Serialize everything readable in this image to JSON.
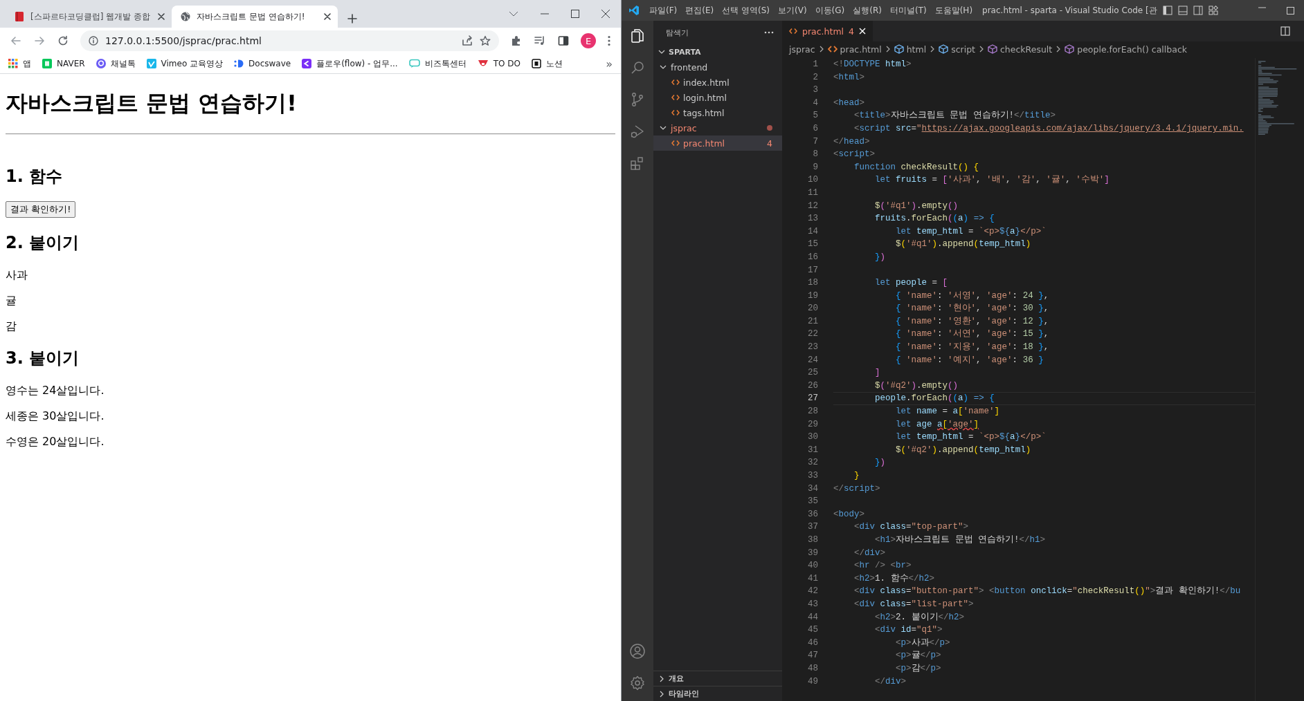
{
  "browser": {
    "tabs": [
      {
        "title": "[스파르타코딩클럽] 웹개발 종합",
        "kind": "book",
        "selected": false
      },
      {
        "title": "자바스크립트 문법 연습하기!",
        "kind": "globe",
        "selected": true
      }
    ],
    "address": "127.0.0.1:5500/jsprac/prac.html",
    "avatar": "E",
    "bookmarks": [
      {
        "label": "앱",
        "kind": "apps"
      },
      {
        "label": "NAVER",
        "kind": "naver"
      },
      {
        "label": "채널톡",
        "kind": "channel"
      },
      {
        "label": "Vimeo 교육영상",
        "kind": "vimeo"
      },
      {
        "label": "Docswave",
        "kind": "docswave"
      },
      {
        "label": "플로우(flow) - 업무...",
        "kind": "flow"
      },
      {
        "label": "비즈톡센터",
        "kind": "biztalk"
      },
      {
        "label": "TO DO",
        "kind": "todo"
      },
      {
        "label": "노션",
        "kind": "notion"
      }
    ],
    "bookmarks_overflow": "»",
    "page": {
      "title": "자바스크립트 문법 연습하기!",
      "sections": [
        {
          "heading": "1. 함수",
          "button": "결과 확인하기!"
        },
        {
          "heading": "2. 붙이기",
          "items": [
            "사과",
            "귤",
            "감"
          ]
        },
        {
          "heading": "3. 붙이기",
          "items": [
            "영수는 24살입니다.",
            "세종은 30살입니다.",
            "수영은 20살입니다."
          ]
        }
      ]
    }
  },
  "vscode": {
    "menu": [
      "파일(F)",
      "편집(E)",
      "선택 영역(S)",
      "보기(V)",
      "이동(G)",
      "실행(R)",
      "터미널(T)",
      "도움말(H)"
    ],
    "title": "prac.html - sparta - Visual Studio Code [관",
    "explorer": {
      "title": "탐색기",
      "root": "SPARTA",
      "tree": [
        {
          "label": "frontend",
          "expanded": true,
          "selected": false,
          "has_errors": false,
          "children": [
            {
              "label": "index.html",
              "selected": false,
              "has_errors": false
            },
            {
              "label": "login.html",
              "selected": false,
              "has_errors": false
            },
            {
              "label": "tags.html",
              "selected": false,
              "has_errors": false
            }
          ]
        },
        {
          "label": "jsprac",
          "expanded": true,
          "selected": false,
          "has_errors": true,
          "children": [
            {
              "label": "prac.html",
              "selected": true,
              "has_errors": true,
              "problems": "4"
            }
          ]
        }
      ],
      "panels": [
        {
          "label": "개요",
          "expanded": false
        },
        {
          "label": "타임라인",
          "expanded": false
        }
      ]
    },
    "editor_tab": {
      "label": "prac.html",
      "problems": "4"
    },
    "breadcrumbs": [
      {
        "label": "jsprac",
        "kind": "folder"
      },
      {
        "label": "prac.html",
        "kind": "file"
      },
      {
        "label": "html",
        "kind": "element"
      },
      {
        "label": "script",
        "kind": "element"
      },
      {
        "label": "checkResult",
        "kind": "method"
      },
      {
        "label": "people.forEach() callback",
        "kind": "method"
      }
    ],
    "lines": [
      {
        "number": "1",
        "current": false,
        "tokens": [
          {
            "kind": "p",
            "text": "<!"
          },
          {
            "kind": "tag",
            "text": "DOCTYPE"
          },
          {
            "kind": "attr",
            "text": " html"
          },
          {
            "kind": "p",
            "text": ">"
          }
        ]
      },
      {
        "number": "2",
        "current": false,
        "tokens": [
          {
            "kind": "p",
            "text": "<"
          },
          {
            "kind": "tag",
            "text": "html"
          },
          {
            "kind": "p",
            "text": ">"
          }
        ]
      },
      {
        "number": "3",
        "current": false
      },
      {
        "number": "4",
        "current": false,
        "tokens": [
          {
            "kind": "p",
            "text": "<"
          },
          {
            "kind": "tag",
            "text": "head"
          },
          {
            "kind": "p",
            "text": ">"
          }
        ]
      },
      {
        "number": "5",
        "current": false,
        "tokens": [
          {
            "kind": "p",
            "text": "    <"
          },
          {
            "kind": "tag",
            "text": "title"
          },
          {
            "kind": "p",
            "text": ">"
          },
          {
            "kind": "txt",
            "text": "자바스크립트 문법 연습하기!"
          },
          {
            "kind": "p",
            "text": "</"
          },
          {
            "kind": "tag",
            "text": "title"
          },
          {
            "kind": "p",
            "text": ">"
          }
        ]
      },
      {
        "number": "6",
        "current": false,
        "tokens": [
          {
            "kind": "p",
            "text": "    <"
          },
          {
            "kind": "tag",
            "text": "script"
          },
          {
            "kind": "attr",
            "text": " src"
          },
          {
            "kind": "txt",
            "text": "="
          },
          {
            "kind": "str",
            "text": "\""
          },
          {
            "kind": "url",
            "text": "https://ajax.googleapis.com/ajax/libs/jquery/3.4.1/jquery.min."
          }
        ]
      },
      {
        "number": "7",
        "current": false,
        "tokens": [
          {
            "kind": "p",
            "text": "</"
          },
          {
            "kind": "tag",
            "text": "head"
          },
          {
            "kind": "p",
            "text": ">"
          }
        ]
      },
      {
        "number": "8",
        "current": false,
        "tokens": [
          {
            "kind": "p",
            "text": "<"
          },
          {
            "kind": "tag",
            "text": "script"
          },
          {
            "kind": "p",
            "text": ">"
          }
        ]
      },
      {
        "number": "9",
        "current": false,
        "tokens": [
          {
            "kind": "kw",
            "text": "    function"
          },
          {
            "kind": "fn",
            "text": " checkResult"
          },
          {
            "kind": "y",
            "text": "()"
          },
          {
            "kind": "y",
            "text": " {"
          }
        ]
      },
      {
        "number": "10",
        "current": false,
        "tokens": [
          {
            "kind": "kw",
            "text": "        let"
          },
          {
            "kind": "var",
            "text": " fruits"
          },
          {
            "kind": "txt",
            "text": " = "
          },
          {
            "kind": "m",
            "text": "["
          },
          {
            "kind": "str",
            "text": "'사과'"
          },
          {
            "kind": "txt",
            "text": ", "
          },
          {
            "kind": "str",
            "text": "'배'"
          },
          {
            "kind": "txt",
            "text": ", "
          },
          {
            "kind": "str",
            "text": "'감'"
          },
          {
            "kind": "txt",
            "text": ", "
          },
          {
            "kind": "str",
            "text": "'귤'"
          },
          {
            "kind": "txt",
            "text": ", "
          },
          {
            "kind": "str",
            "text": "'수박'"
          },
          {
            "kind": "m",
            "text": "]"
          }
        ]
      },
      {
        "number": "11",
        "current": false
      },
      {
        "number": "12",
        "current": false,
        "tokens": [
          {
            "kind": "fn",
            "text": "        $"
          },
          {
            "kind": "m",
            "text": "("
          },
          {
            "kind": "str",
            "text": "'#q1'"
          },
          {
            "kind": "m",
            "text": ")"
          },
          {
            "kind": "txt",
            "text": "."
          },
          {
            "kind": "fn",
            "text": "empty"
          },
          {
            "kind": "m",
            "text": "()"
          }
        ]
      },
      {
        "number": "13",
        "current": false,
        "tokens": [
          {
            "kind": "var",
            "text": "        fruits"
          },
          {
            "kind": "txt",
            "text": "."
          },
          {
            "kind": "fn",
            "text": "forEach"
          },
          {
            "kind": "m",
            "text": "("
          },
          {
            "kind": "b",
            "text": "("
          },
          {
            "kind": "var",
            "text": "a"
          },
          {
            "kind": "b",
            "text": ")"
          },
          {
            "kind": "kw",
            "text": " =>"
          },
          {
            "kind": "b",
            "text": " {"
          }
        ]
      },
      {
        "number": "14",
        "current": false,
        "tokens": [
          {
            "kind": "kw",
            "text": "            let"
          },
          {
            "kind": "var",
            "text": " temp_html"
          },
          {
            "kind": "txt",
            "text": " = "
          },
          {
            "kind": "str",
            "text": "`<p>"
          },
          {
            "kind": "kw",
            "text": "${"
          },
          {
            "kind": "var",
            "text": "a"
          },
          {
            "kind": "kw",
            "text": "}"
          },
          {
            "kind": "str",
            "text": "</p>`"
          }
        ]
      },
      {
        "number": "15",
        "current": false,
        "tokens": [
          {
            "kind": "fn",
            "text": "            $"
          },
          {
            "kind": "y",
            "text": "("
          },
          {
            "kind": "str",
            "text": "'#q1'"
          },
          {
            "kind": "y",
            "text": ")"
          },
          {
            "kind": "txt",
            "text": "."
          },
          {
            "kind": "fn",
            "text": "append"
          },
          {
            "kind": "y",
            "text": "("
          },
          {
            "kind": "var",
            "text": "temp_html"
          },
          {
            "kind": "y",
            "text": ")"
          }
        ]
      },
      {
        "number": "16",
        "current": false,
        "tokens": [
          {
            "kind": "b",
            "text": "        }"
          },
          {
            "kind": "m",
            "text": ")"
          }
        ]
      },
      {
        "number": "17",
        "current": false
      },
      {
        "number": "18",
        "current": false,
        "tokens": [
          {
            "kind": "kw",
            "text": "        let"
          },
          {
            "kind": "var",
            "text": " people"
          },
          {
            "kind": "txt",
            "text": " = "
          },
          {
            "kind": "m",
            "text": "["
          }
        ]
      },
      {
        "number": "19",
        "current": false,
        "tokens": [
          {
            "kind": "b",
            "text": "            {"
          },
          {
            "kind": "str",
            "text": " 'name'"
          },
          {
            "kind": "txt",
            "text": ": "
          },
          {
            "kind": "str",
            "text": "'서영'"
          },
          {
            "kind": "txt",
            "text": ", "
          },
          {
            "kind": "str",
            "text": "'age'"
          },
          {
            "kind": "txt",
            "text": ": "
          },
          {
            "kind": "num",
            "text": "24"
          },
          {
            "kind": "b",
            "text": " }"
          },
          {
            "kind": "txt",
            "text": ","
          }
        ]
      },
      {
        "number": "20",
        "current": false,
        "tokens": [
          {
            "kind": "b",
            "text": "            {"
          },
          {
            "kind": "str",
            "text": " 'name'"
          },
          {
            "kind": "txt",
            "text": ": "
          },
          {
            "kind": "str",
            "text": "'현아'"
          },
          {
            "kind": "txt",
            "text": ", "
          },
          {
            "kind": "str",
            "text": "'age'"
          },
          {
            "kind": "txt",
            "text": ": "
          },
          {
            "kind": "num",
            "text": "30"
          },
          {
            "kind": "b",
            "text": " }"
          },
          {
            "kind": "txt",
            "text": ","
          }
        ]
      },
      {
        "number": "21",
        "current": false,
        "tokens": [
          {
            "kind": "b",
            "text": "            {"
          },
          {
            "kind": "str",
            "text": " 'name'"
          },
          {
            "kind": "txt",
            "text": ": "
          },
          {
            "kind": "str",
            "text": "'영환'"
          },
          {
            "kind": "txt",
            "text": ", "
          },
          {
            "kind": "str",
            "text": "'age'"
          },
          {
            "kind": "txt",
            "text": ": "
          },
          {
            "kind": "num",
            "text": "12"
          },
          {
            "kind": "b",
            "text": " }"
          },
          {
            "kind": "txt",
            "text": ","
          }
        ]
      },
      {
        "number": "22",
        "current": false,
        "tokens": [
          {
            "kind": "b",
            "text": "            {"
          },
          {
            "kind": "str",
            "text": " 'name'"
          },
          {
            "kind": "txt",
            "text": ": "
          },
          {
            "kind": "str",
            "text": "'서연'"
          },
          {
            "kind": "txt",
            "text": ", "
          },
          {
            "kind": "str",
            "text": "'age'"
          },
          {
            "kind": "txt",
            "text": ": "
          },
          {
            "kind": "num",
            "text": "15"
          },
          {
            "kind": "b",
            "text": " }"
          },
          {
            "kind": "txt",
            "text": ","
          }
        ]
      },
      {
        "number": "23",
        "current": false,
        "tokens": [
          {
            "kind": "b",
            "text": "            {"
          },
          {
            "kind": "str",
            "text": " 'name'"
          },
          {
            "kind": "txt",
            "text": ": "
          },
          {
            "kind": "str",
            "text": "'지용'"
          },
          {
            "kind": "txt",
            "text": ", "
          },
          {
            "kind": "str",
            "text": "'age'"
          },
          {
            "kind": "txt",
            "text": ": "
          },
          {
            "kind": "num",
            "text": "18"
          },
          {
            "kind": "b",
            "text": " }"
          },
          {
            "kind": "txt",
            "text": ","
          }
        ]
      },
      {
        "number": "24",
        "current": false,
        "tokens": [
          {
            "kind": "b",
            "text": "            {"
          },
          {
            "kind": "str",
            "text": " 'name'"
          },
          {
            "kind": "txt",
            "text": ": "
          },
          {
            "kind": "str",
            "text": "'예지'"
          },
          {
            "kind": "txt",
            "text": ", "
          },
          {
            "kind": "str",
            "text": "'age'"
          },
          {
            "kind": "txt",
            "text": ": "
          },
          {
            "kind": "num",
            "text": "36"
          },
          {
            "kind": "b",
            "text": " }"
          }
        ]
      },
      {
        "number": "25",
        "current": false,
        "tokens": [
          {
            "kind": "m",
            "text": "        ]"
          }
        ]
      },
      {
        "number": "26",
        "current": false,
        "tokens": [
          {
            "kind": "fn",
            "text": "        $"
          },
          {
            "kind": "m",
            "text": "("
          },
          {
            "kind": "str",
            "text": "'#q2'"
          },
          {
            "kind": "m",
            "text": ")"
          },
          {
            "kind": "txt",
            "text": "."
          },
          {
            "kind": "fn",
            "text": "empty"
          },
          {
            "kind": "m",
            "text": "()"
          }
        ]
      },
      {
        "number": "27",
        "current": true,
        "tokens": [
          {
            "kind": "var",
            "text": "        people"
          },
          {
            "kind": "txt",
            "text": "."
          },
          {
            "kind": "fn",
            "text": "forEach"
          },
          {
            "kind": "m",
            "text": "("
          },
          {
            "kind": "b",
            "text": "("
          },
          {
            "kind": "var",
            "text": "a"
          },
          {
            "kind": "b",
            "text": ")"
          },
          {
            "kind": "kw",
            "text": " =>"
          },
          {
            "kind": "b",
            "text": " {"
          }
        ]
      },
      {
        "number": "28",
        "current": false,
        "tokens": [
          {
            "kind": "kw",
            "text": "            let"
          },
          {
            "kind": "var",
            "text": " name"
          },
          {
            "kind": "txt",
            "text": " = "
          },
          {
            "kind": "var",
            "text": "a"
          },
          {
            "kind": "y",
            "text": "["
          },
          {
            "kind": "str",
            "text": "'name'"
          },
          {
            "kind": "y",
            "text": "]"
          }
        ]
      },
      {
        "number": "29",
        "current": false,
        "tokens": [
          {
            "kind": "kw",
            "text": "            let"
          },
          {
            "kind": "var",
            "text": " age "
          },
          {
            "kind": "var_err",
            "text": "a"
          },
          {
            "kind": "y_err",
            "text": "["
          },
          {
            "kind": "str_err",
            "text": "'age'"
          },
          {
            "kind": "y_err",
            "text": "]"
          }
        ]
      },
      {
        "number": "30",
        "current": false,
        "tokens": [
          {
            "kind": "kw",
            "text": "            let"
          },
          {
            "kind": "var",
            "text": " temp_html"
          },
          {
            "kind": "txt",
            "text": " = "
          },
          {
            "kind": "str",
            "text": "`<p>"
          },
          {
            "kind": "kw",
            "text": "${"
          },
          {
            "kind": "var",
            "text": "a"
          },
          {
            "kind": "kw",
            "text": "}"
          },
          {
            "kind": "str",
            "text": "</p>`"
          }
        ]
      },
      {
        "number": "31",
        "current": false,
        "tokens": [
          {
            "kind": "fn",
            "text": "            $"
          },
          {
            "kind": "y",
            "text": "("
          },
          {
            "kind": "str",
            "text": "'#q2'"
          },
          {
            "kind": "y",
            "text": ")"
          },
          {
            "kind": "txt",
            "text": "."
          },
          {
            "kind": "fn",
            "text": "append"
          },
          {
            "kind": "y",
            "text": "("
          },
          {
            "kind": "var",
            "text": "temp_html"
          },
          {
            "kind": "y",
            "text": ")"
          }
        ]
      },
      {
        "number": "32",
        "current": false,
        "tokens": [
          {
            "kind": "b",
            "text": "        }"
          },
          {
            "kind": "m",
            "text": ")"
          }
        ]
      },
      {
        "number": "33",
        "current": false,
        "tokens": [
          {
            "kind": "y",
            "text": "    }"
          }
        ]
      },
      {
        "number": "34",
        "current": false,
        "tokens": [
          {
            "kind": "p",
            "text": "</"
          },
          {
            "kind": "tag",
            "text": "script"
          },
          {
            "kind": "p",
            "text": ">"
          }
        ]
      },
      {
        "number": "35",
        "current": false
      },
      {
        "number": "36",
        "current": false,
        "tokens": [
          {
            "kind": "p",
            "text": "<"
          },
          {
            "kind": "tag",
            "text": "body"
          },
          {
            "kind": "p",
            "text": ">"
          }
        ]
      },
      {
        "number": "37",
        "current": false,
        "tokens": [
          {
            "kind": "p",
            "text": "    <"
          },
          {
            "kind": "tag",
            "text": "div"
          },
          {
            "kind": "attr",
            "text": " class"
          },
          {
            "kind": "txt",
            "text": "="
          },
          {
            "kind": "str",
            "text": "\"top-part\""
          },
          {
            "kind": "p",
            "text": ">"
          }
        ]
      },
      {
        "number": "38",
        "current": false,
        "tokens": [
          {
            "kind": "p",
            "text": "        <"
          },
          {
            "kind": "tag",
            "text": "h1"
          },
          {
            "kind": "p",
            "text": ">"
          },
          {
            "kind": "txt",
            "text": "자바스크립트 문법 연습하기!"
          },
          {
            "kind": "p",
            "text": "</"
          },
          {
            "kind": "tag",
            "text": "h1"
          },
          {
            "kind": "p",
            "text": ">"
          }
        ]
      },
      {
        "number": "39",
        "current": false,
        "tokens": [
          {
            "kind": "p",
            "text": "    </"
          },
          {
            "kind": "tag",
            "text": "div"
          },
          {
            "kind": "p",
            "text": ">"
          }
        ]
      },
      {
        "number": "40",
        "current": false,
        "tokens": [
          {
            "kind": "p",
            "text": "    <"
          },
          {
            "kind": "tag",
            "text": "hr"
          },
          {
            "kind": "p",
            "text": " /> <"
          },
          {
            "kind": "tag",
            "text": "br"
          },
          {
            "kind": "p",
            "text": ">"
          }
        ]
      },
      {
        "number": "41",
        "current": false,
        "tokens": [
          {
            "kind": "p",
            "text": "    <"
          },
          {
            "kind": "tag",
            "text": "h2"
          },
          {
            "kind": "p",
            "text": ">"
          },
          {
            "kind": "txt",
            "text": "1. 함수"
          },
          {
            "kind": "p",
            "text": "</"
          },
          {
            "kind": "tag",
            "text": "h2"
          },
          {
            "kind": "p",
            "text": ">"
          }
        ]
      },
      {
        "number": "42",
        "current": false,
        "tokens": [
          {
            "kind": "p",
            "text": "    <"
          },
          {
            "kind": "tag",
            "text": "div"
          },
          {
            "kind": "attr",
            "text": " class"
          },
          {
            "kind": "txt",
            "text": "="
          },
          {
            "kind": "str",
            "text": "\"button-part\""
          },
          {
            "kind": "p",
            "text": "> <"
          },
          {
            "kind": "tag",
            "text": "button"
          },
          {
            "kind": "attr",
            "text": " onclick"
          },
          {
            "kind": "txt",
            "text": "="
          },
          {
            "kind": "str",
            "text": "\""
          },
          {
            "kind": "fn",
            "text": "checkResult"
          },
          {
            "kind": "y",
            "text": "()"
          },
          {
            "kind": "str",
            "text": "\""
          },
          {
            "kind": "p",
            "text": ">"
          },
          {
            "kind": "txt",
            "text": "결과 확인하기!"
          },
          {
            "kind": "p",
            "text": "</"
          },
          {
            "kind": "tag",
            "text": "bu"
          }
        ]
      },
      {
        "number": "43",
        "current": false,
        "tokens": [
          {
            "kind": "p",
            "text": "    <"
          },
          {
            "kind": "tag",
            "text": "div"
          },
          {
            "kind": "attr",
            "text": " class"
          },
          {
            "kind": "txt",
            "text": "="
          },
          {
            "kind": "str",
            "text": "\"list-part\""
          },
          {
            "kind": "p",
            "text": ">"
          }
        ]
      },
      {
        "number": "44",
        "current": false,
        "tokens": [
          {
            "kind": "p",
            "text": "        <"
          },
          {
            "kind": "tag",
            "text": "h2"
          },
          {
            "kind": "p",
            "text": ">"
          },
          {
            "kind": "txt",
            "text": "2. 붙이기"
          },
          {
            "kind": "p",
            "text": "</"
          },
          {
            "kind": "tag",
            "text": "h2"
          },
          {
            "kind": "p",
            "text": ">"
          }
        ]
      },
      {
        "number": "45",
        "current": false,
        "tokens": [
          {
            "kind": "p",
            "text": "        <"
          },
          {
            "kind": "tag",
            "text": "div"
          },
          {
            "kind": "attr",
            "text": " id"
          },
          {
            "kind": "txt",
            "text": "="
          },
          {
            "kind": "str",
            "text": "\"q1\""
          },
          {
            "kind": "p",
            "text": ">"
          }
        ]
      },
      {
        "number": "46",
        "current": false,
        "tokens": [
          {
            "kind": "p",
            "text": "            <"
          },
          {
            "kind": "tag",
            "text": "p"
          },
          {
            "kind": "p",
            "text": ">"
          },
          {
            "kind": "txt",
            "text": "사과"
          },
          {
            "kind": "p",
            "text": "</"
          },
          {
            "kind": "tag",
            "text": "p"
          },
          {
            "kind": "p",
            "text": ">"
          }
        ]
      },
      {
        "number": "47",
        "current": false,
        "tokens": [
          {
            "kind": "p",
            "text": "            <"
          },
          {
            "kind": "tag",
            "text": "p"
          },
          {
            "kind": "p",
            "text": ">"
          },
          {
            "kind": "txt",
            "text": "귤"
          },
          {
            "kind": "p",
            "text": "</"
          },
          {
            "kind": "tag",
            "text": "p"
          },
          {
            "kind": "p",
            "text": ">"
          }
        ]
      },
      {
        "number": "48",
        "current": false,
        "tokens": [
          {
            "kind": "p",
            "text": "            <"
          },
          {
            "kind": "tag",
            "text": "p"
          },
          {
            "kind": "p",
            "text": ">"
          },
          {
            "kind": "txt",
            "text": "감"
          },
          {
            "kind": "p",
            "text": "</"
          },
          {
            "kind": "tag",
            "text": "p"
          },
          {
            "kind": "p",
            "text": ">"
          }
        ]
      },
      {
        "number": "49",
        "current": false,
        "tokens": [
          {
            "kind": "p",
            "text": "        </"
          },
          {
            "kind": "tag",
            "text": "div"
          },
          {
            "kind": "p",
            "text": ">"
          }
        ]
      }
    ]
  }
}
